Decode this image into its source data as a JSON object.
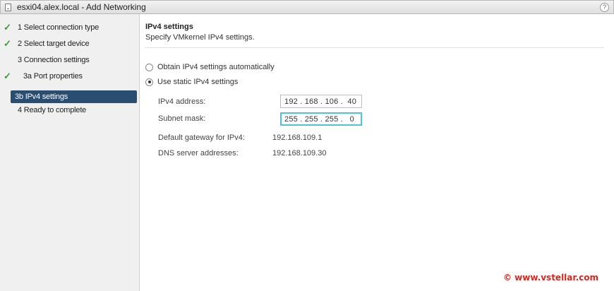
{
  "window": {
    "title": "esxi04.alex.local - Add Networking",
    "help_label": "?"
  },
  "steps": [
    {
      "label": "1  Select connection type",
      "done": true
    },
    {
      "label": "2  Select target device",
      "done": true
    },
    {
      "label": "3  Connection settings",
      "done": false
    },
    {
      "label": "3a  Port properties",
      "done": true
    },
    {
      "label": "3b  IPv4 settings",
      "done": false,
      "active": true
    },
    {
      "label": "4  Ready to complete",
      "done": false
    }
  ],
  "page": {
    "title": "IPv4 settings",
    "subtitle": "Specify VMkernel IPv4 settings."
  },
  "options": {
    "auto": {
      "label": "Obtain IPv4 settings automatically",
      "selected": false
    },
    "static": {
      "label": "Use static IPv4 settings",
      "selected": true
    }
  },
  "fields": {
    "ipv4_address": {
      "label": "IPv4 address:",
      "value": "192 . 168 . 106 .  40"
    },
    "subnet_mask": {
      "label": "Subnet mask:",
      "value": "255 . 255 . 255 .   0"
    },
    "gateway": {
      "label": "Default gateway for IPv4:",
      "value": "192.168.109.1"
    },
    "dns": {
      "label": "DNS server addresses:",
      "value": "192.168.109.30"
    }
  },
  "watermark": "© www.vstellar.com",
  "colors": {
    "accent_selected": "#2a4d72",
    "check": "#3d9b35",
    "focus": "#49c5dd",
    "watermark": "#d7261f"
  }
}
